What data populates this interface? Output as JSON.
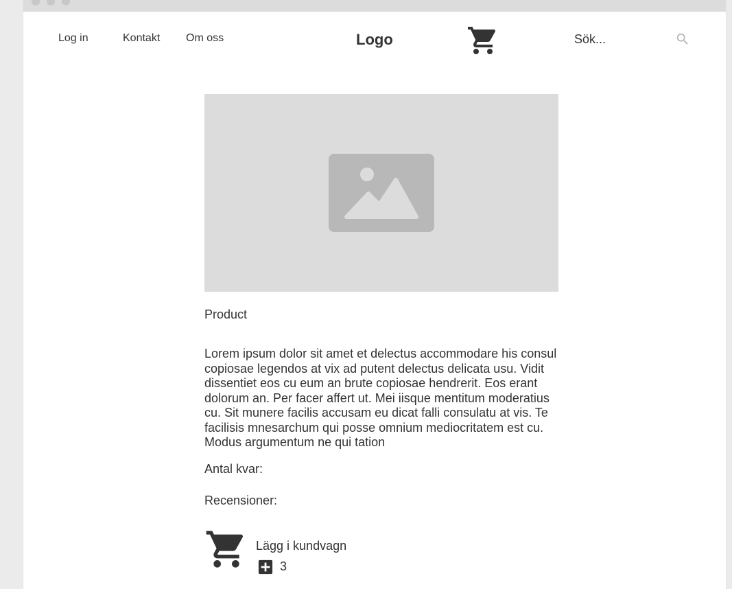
{
  "nav": {
    "login": "Log in",
    "contact": "Kontakt",
    "about": "Om oss"
  },
  "header": {
    "logo": "Logo",
    "cart_icon": "shopping-cart-icon",
    "search_placeholder": "Sök...",
    "search_icon": "search-icon"
  },
  "product": {
    "image_icon": "image-placeholder-icon",
    "title": "Product",
    "description": "Lorem ipsum dolor sit amet et delectus accommodare his consul copiosae legendos at vix ad putent delectus delicata usu. Vidit dissentiet eos cu eum an brute copiosae hendrerit. Eos erant dolorum an. Per facer affert ut. Mei iisque mentitum moderatius cu. Sit munere facilis accusam eu dicat falli consulatu at vis. Te facilisis mnesarchum qui posse omnium mediocritatem est cu. Modus argumentum ne qui tation",
    "stock_label": "Antal kvar:",
    "reviews_label": "Recensioner:",
    "add_to_cart_label": "Lägg i kundvagn",
    "quantity": "3"
  },
  "colors": {
    "text": "#333333",
    "placeholder_bg": "#dcdcdc",
    "icon_gray": "#b8b8b8",
    "titlebar": "#dcdcdc"
  }
}
